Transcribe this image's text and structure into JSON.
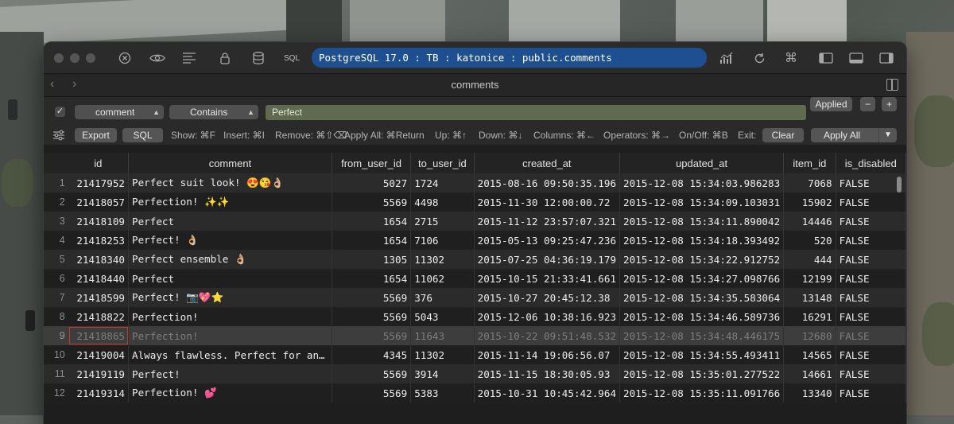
{
  "toolbar": {
    "connection": "PostgreSQL 17.0 : TB : katonice : public.comments",
    "sql_label": "SQL"
  },
  "tab": {
    "title": "comments"
  },
  "filter": {
    "column": "comment",
    "operator": "Contains",
    "value": "Perfect",
    "applied_label": "Applied",
    "minus_label": "−",
    "plus_label": "+"
  },
  "actions": {
    "export_label": "Export",
    "sql_label": "SQL",
    "clear_label": "Clear",
    "apply_all_label": "Apply All",
    "hints": [
      "Show: ⌘F",
      "Insert: ⌘I",
      "Remove: ⌘⇧⌫",
      "Apply All: ⌘Return",
      "Up: ⌘↑",
      "Down: ⌘↓",
      "Columns: ⌘←",
      "Operators: ⌘→",
      "On/Off: ⌘B",
      "Exit:"
    ]
  },
  "table": {
    "columns": [
      "id",
      "comment",
      "from_user_id",
      "to_user_id",
      "created_at",
      "updated_at",
      "item_id",
      "is_disabled"
    ],
    "rows": [
      {
        "n": "1",
        "id": "21417952",
        "comment": "Perfect suit look! 😍😘👌🏼",
        "from": "5027",
        "to": "1724",
        "created": "2015-08-16 09:50:35.196",
        "updated": "2015-12-08 15:34:03.986283",
        "item": "7068",
        "disabled": "FALSE"
      },
      {
        "n": "2",
        "id": "21418057",
        "comment": "Perfection! ✨✨",
        "from": "5569",
        "to": "4498",
        "created": "2015-11-30 12:00:00.72",
        "updated": "2015-12-08 15:34:09.103031",
        "item": "15902",
        "disabled": "FALSE"
      },
      {
        "n": "3",
        "id": "21418109",
        "comment": " Perfect",
        "from": "1654",
        "to": "2715",
        "created": "2015-11-12 23:57:07.321",
        "updated": "2015-12-08 15:34:11.890042",
        "item": "14446",
        "disabled": "FALSE"
      },
      {
        "n": "4",
        "id": "21418253",
        "comment": "Perfect! 👌🏼",
        "from": "1654",
        "to": "7106",
        "created": "2015-05-13 09:25:47.236",
        "updated": "2015-12-08 15:34:18.393492",
        "item": "520",
        "disabled": "FALSE"
      },
      {
        "n": "5",
        "id": "21418340",
        "comment": "Perfect ensemble 👌🏼",
        "from": "1305",
        "to": "11302",
        "created": "2015-07-25 04:36:19.179",
        "updated": "2015-12-08 15:34:22.912752",
        "item": "444",
        "disabled": "FALSE"
      },
      {
        "n": "6",
        "id": "21418440",
        "comment": "Perfect",
        "from": "1654",
        "to": "11062",
        "created": "2015-10-15 21:33:41.661",
        "updated": "2015-12-08 15:34:27.098766",
        "item": "12199",
        "disabled": "FALSE"
      },
      {
        "n": "7",
        "id": "21418599",
        "comment": "Perfect! 📷💖⭐",
        "from": "5569",
        "to": "376",
        "created": "2015-10-27 20:45:12.38",
        "updated": "2015-12-08 15:34:35.583064",
        "item": "13148",
        "disabled": "FALSE"
      },
      {
        "n": "8",
        "id": "21418822",
        "comment": "Perfection!",
        "from": "5569",
        "to": "5043",
        "created": "2015-12-06 10:38:16.923",
        "updated": "2015-12-08 15:34:46.589736",
        "item": "16291",
        "disabled": "FALSE"
      },
      {
        "n": "9",
        "id": "21418865",
        "comment": "Perfection!",
        "from": "5569",
        "to": "11643",
        "created": "2015-10-22 09:51:48.532",
        "updated": "2015-12-08 15:34:48.446175",
        "item": "12680",
        "disabled": "FALSE"
      },
      {
        "n": "10",
        "id": "21419004",
        "comment": "Always flawless. Perfect for an…",
        "from": "4345",
        "to": "11302",
        "created": "2015-11-14 19:06:56.07",
        "updated": "2015-12-08 15:34:55.493411",
        "item": "14565",
        "disabled": "FALSE"
      },
      {
        "n": "11",
        "id": "21419119",
        "comment": "Perfect!",
        "from": "5569",
        "to": "3914",
        "created": "2015-11-15 18:30:05.93",
        "updated": "2015-12-08 15:35:01.277522",
        "item": "14661",
        "disabled": "FALSE"
      },
      {
        "n": "12",
        "id": "21419314",
        "comment": "Perfection! 💕",
        "from": "5569",
        "to": "5383",
        "created": "2015-10-31 10:45:42.964",
        "updated": "2015-12-08 15:35:11.091766",
        "item": "13340",
        "disabled": "FALSE"
      }
    ],
    "selected_row": 8
  },
  "colors": {
    "connection_pill": "#1d4f91",
    "filter_value_bg": "#5f6a50",
    "cursor_outline": "#c0392b"
  },
  "icons": [
    "close-circle-icon",
    "eye-icon",
    "list-icon",
    "lock-icon",
    "database-icon",
    "chart-icon",
    "refresh-icon",
    "command-icon",
    "sidebar-left-icon",
    "panel-bottom-icon",
    "sidebar-right-icon",
    "split-view-icon",
    "sliders-icon"
  ]
}
